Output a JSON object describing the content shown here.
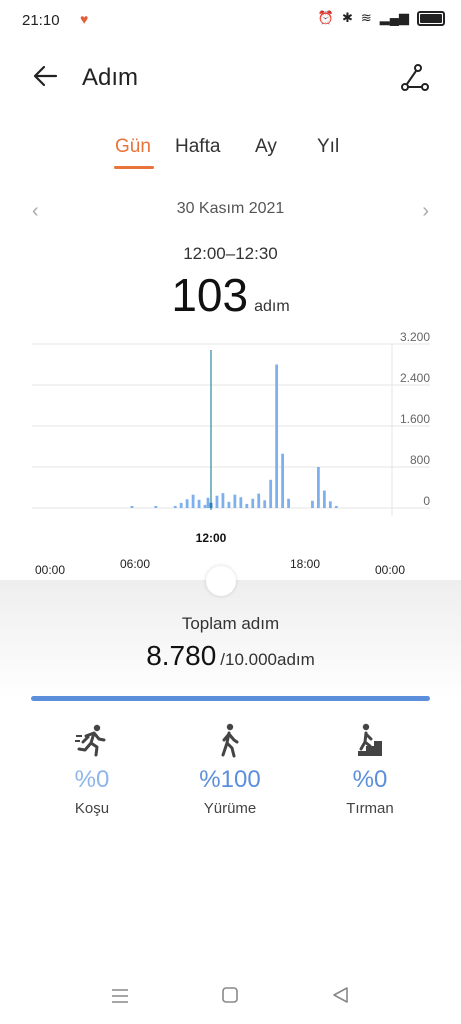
{
  "status": {
    "time": "21:10"
  },
  "header": {
    "title": "Adım"
  },
  "tabs": [
    {
      "label": "Gün",
      "active": true
    },
    {
      "label": "Hafta",
      "active": false
    },
    {
      "label": "Ay",
      "active": false
    },
    {
      "label": "Yıl",
      "active": false
    }
  ],
  "date": "30 Kasım 2021",
  "selection": {
    "range": "12:00–12:30",
    "value": "103",
    "unit": "adım"
  },
  "chart_data": {
    "type": "bar",
    "y_ticks": [
      "3.200",
      "2.400",
      "1.600",
      "800",
      "0"
    ],
    "ylim": [
      0,
      3200
    ],
    "x_labels": [
      "00:00",
      "06:00",
      "12:00",
      "18:00",
      "00:00"
    ],
    "selected_label": "12:00",
    "values": [
      0,
      0,
      0,
      0,
      0,
      0,
      0,
      0,
      0,
      0,
      0,
      0,
      0,
      0,
      0,
      0,
      0,
      0,
      0,
      0,
      0,
      0,
      0,
      0,
      0,
      0,
      0,
      0,
      0,
      0,
      0,
      0,
      0,
      0,
      0,
      0,
      0,
      0,
      0,
      0,
      0,
      0,
      0,
      0,
      0,
      0,
      0,
      0,
      0,
      0,
      0,
      0,
      0,
      0,
      0,
      0,
      0,
      0,
      0,
      0,
      0,
      0,
      0,
      0,
      0,
      0,
      0,
      0,
      0,
      0,
      0,
      0,
      0,
      0,
      0,
      0,
      0,
      0,
      0,
      0,
      0,
      0,
      0,
      0,
      0,
      0,
      0,
      0,
      0,
      0,
      0,
      0,
      0,
      0,
      0,
      0,
      0,
      0,
      0,
      0,
      0,
      0,
      0,
      0,
      0,
      0,
      0,
      0,
      0,
      0,
      0,
      0,
      0,
      0,
      0,
      0,
      0,
      0,
      0,
      0
    ],
    "bars": [
      {
        "t": 6.7,
        "v": 30
      },
      {
        "t": 8.3,
        "v": 30
      },
      {
        "t": 9.6,
        "v": 40
      },
      {
        "t": 10.0,
        "v": 100
      },
      {
        "t": 10.4,
        "v": 170
      },
      {
        "t": 10.8,
        "v": 260
      },
      {
        "t": 11.2,
        "v": 160
      },
      {
        "t": 11.6,
        "v": 60
      },
      {
        "t": 11.8,
        "v": 200
      },
      {
        "t": 12.0,
        "v": 103
      },
      {
        "t": 12.4,
        "v": 240
      },
      {
        "t": 12.8,
        "v": 290
      },
      {
        "t": 13.2,
        "v": 120
      },
      {
        "t": 13.6,
        "v": 260
      },
      {
        "t": 14.0,
        "v": 210
      },
      {
        "t": 14.4,
        "v": 80
      },
      {
        "t": 14.8,
        "v": 180
      },
      {
        "t": 15.2,
        "v": 280
      },
      {
        "t": 15.6,
        "v": 150
      },
      {
        "t": 16.0,
        "v": 550
      },
      {
        "t": 16.4,
        "v": 2800
      },
      {
        "t": 16.8,
        "v": 1060
      },
      {
        "t": 17.2,
        "v": 180
      },
      {
        "t": 18.8,
        "v": 140
      },
      {
        "t": 19.2,
        "v": 800
      },
      {
        "t": 19.6,
        "v": 340
      },
      {
        "t": 20.0,
        "v": 130
      },
      {
        "t": 20.4,
        "v": 40
      }
    ]
  },
  "summary": {
    "label": "Toplam adım",
    "value": "8.780",
    "goal": "/10.000adım",
    "progress": 0.878
  },
  "stats": [
    {
      "pct": "%0",
      "label": "Koşu",
      "icon": "running-icon",
      "color": "#8fb6ea"
    },
    {
      "pct": "%100",
      "label": "Yürüme",
      "icon": "walking-icon",
      "color": "#5b8fdc"
    },
    {
      "pct": "%0",
      "label": "Tırman",
      "icon": "climbing-icon",
      "color": "#5b8fdc"
    }
  ],
  "navbar": {
    "icons": [
      "menu-icon",
      "home-icon",
      "back-icon"
    ]
  }
}
